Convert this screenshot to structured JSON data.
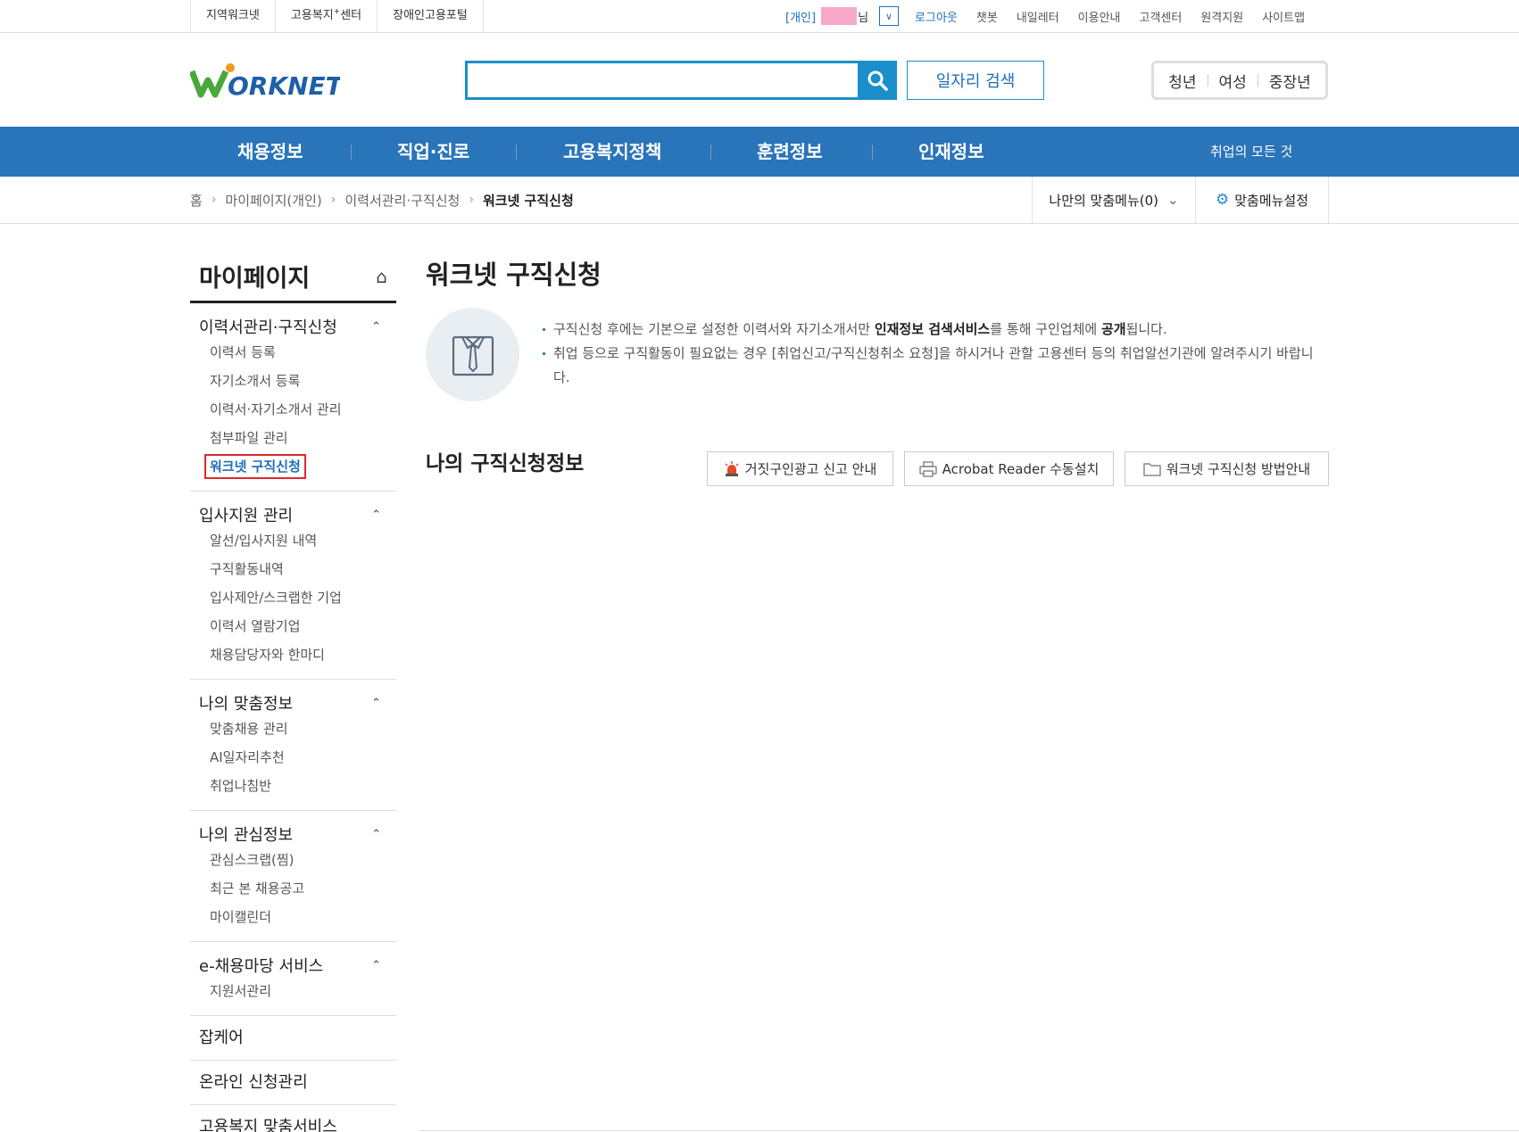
{
  "util": {
    "left_links": [
      "지역워크넷",
      "고용복지",
      "장애인고용포털"
    ],
    "welfare_sup": "+",
    "welfare_suffix": "센터",
    "account_type": "[개인]",
    "name_suffix": "님",
    "logout": "로그아웃",
    "links": [
      "챗봇",
      "내일레터",
      "이용안내",
      "고객센터",
      "원격지원",
      "사이트맵"
    ]
  },
  "header": {
    "logo_text": "WORKNET",
    "search_placeholder": "",
    "job_search": "일자리 검색",
    "targets": [
      "청년",
      "여성",
      "중장년"
    ]
  },
  "gnb": {
    "items": [
      "채용정보",
      "직업·진로",
      "고용복지정책",
      "훈련정보",
      "인재정보"
    ],
    "right": "취업의 모든 것"
  },
  "breadcrumb": {
    "items": [
      "홈",
      "마이페이지(개인)",
      "이력서관리·구직신청",
      "워크넷 구직신청"
    ],
    "my_menu": "나만의 맞춤메뉴(0)",
    "menu_setting": "맞춤메뉴설정"
  },
  "sidebar": {
    "title": "마이페이지",
    "groups": [
      {
        "title": "이력서관리·구직신청",
        "items": [
          "이력서 등록",
          "자기소개서 등록",
          "이력서·자기소개서 관리",
          "첨부파일 관리",
          "워크넷 구직신청"
        ]
      },
      {
        "title": "입사지원 관리",
        "items": [
          "알선/입사지원 내역",
          "구직활동내역",
          "입사제안/스크랩한 기업",
          "이력서 열람기업",
          "채용담당자와 한마디"
        ]
      },
      {
        "title": "나의 맞춤정보",
        "items": [
          "맞춤채용 관리",
          "AI일자리추천",
          "취업나침반"
        ]
      },
      {
        "title": "나의 관심정보",
        "items": [
          "관심스크랩(찜)",
          "최근 본 채용공고",
          "마이캘린더"
        ]
      },
      {
        "title": "e-채용마당 서비스",
        "items": [
          "지원서관리"
        ]
      }
    ],
    "singles": [
      "잡케어",
      "온라인 신청관리",
      "고용복지 맞춤서비스"
    ]
  },
  "content": {
    "title": "워크넷 구직신청",
    "notice1_a": "구직신청 후에는 기본으로 설정한 이력서와 자기소개서만 ",
    "notice1_b": "인재정보 검색서비스",
    "notice1_c": "를 통해 구인업체에 ",
    "notice1_d": "공개",
    "notice1_e": "됩니다.",
    "notice2": "취업 등으로 구직활동이 필요없는 경우 [취업신고/구직신청취소 요청]을 하시거나 관할 고용센터 등의 취업알선기관에 알려주시기 바랍니다.",
    "section_title": "나의 구직신청정보",
    "buttons": [
      "거짓구인광고 신고 안내",
      "Acrobat Reader 수동설치",
      "워크넷 구직신청 방법안내"
    ]
  },
  "colors": {
    "gnb": "#2a74b9",
    "search": "#1a8fc9",
    "active_border": "#e0282e",
    "link": "#1e6fb7"
  }
}
